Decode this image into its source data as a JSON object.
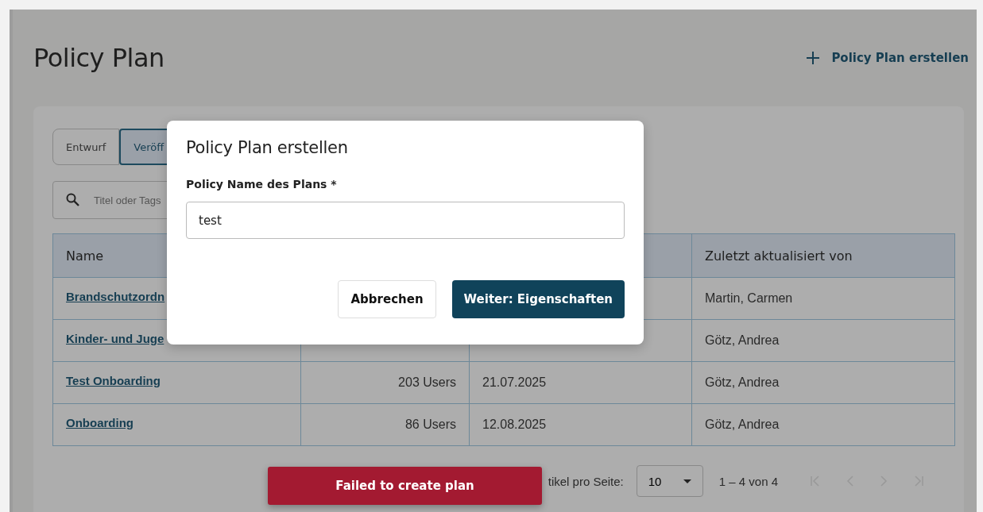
{
  "page": {
    "title": "Policy Plan",
    "create_action": "Policy Plan erstellen"
  },
  "tabs": [
    {
      "label": "Entwurf",
      "selected": false
    },
    {
      "label": "Veröff",
      "selected": true
    }
  ],
  "search": {
    "placeholder": "Titel oder Tags"
  },
  "table": {
    "columns": [
      "Name",
      null,
      null,
      "Zuletzt aktualisiert von"
    ],
    "rows": [
      {
        "name": "Brandschutzordn",
        "updated_by": "Martin, Carmen"
      },
      {
        "name": "Kinder- und Juge",
        "updated_by": "Götz, Andrea"
      },
      {
        "name": "Test Onboarding",
        "users": "203 Users",
        "date": "21.07.2025",
        "updated_by": "Götz, Andrea"
      },
      {
        "name": "Onboarding",
        "users": "86 Users",
        "date": "12.08.2025",
        "updated_by": "Götz, Andrea"
      }
    ]
  },
  "pagination": {
    "label": "tikel pro Seite:",
    "page_size": "10",
    "range": "1 – 4 von 4"
  },
  "dialog": {
    "title": "Policy Plan erstellen",
    "field_label": "Policy Name des Plans *",
    "field_value": "test",
    "buttons": [
      {
        "label": "Abbrechen",
        "kind": "secondary"
      },
      {
        "label": "Weiter: Eigenschaften",
        "kind": "primary"
      }
    ]
  },
  "toast": {
    "message": "Failed to create plan"
  }
}
